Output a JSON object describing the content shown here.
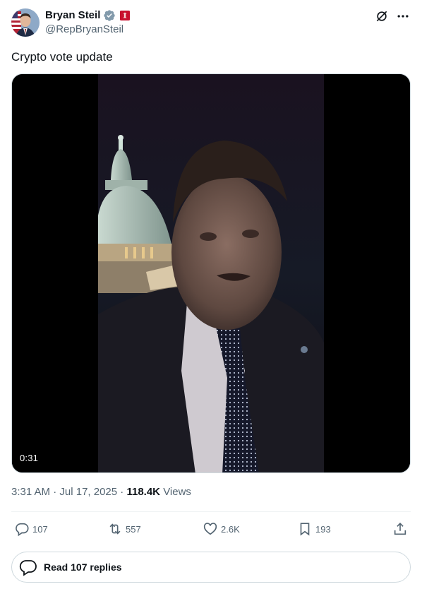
{
  "author": {
    "display_name": "Bryan Steil",
    "handle": "@RepBryanSteil",
    "verified_icon": "verified-badge-icon",
    "affiliation_icon": "house-seal-icon"
  },
  "tweet": {
    "text": "Crypto vote update"
  },
  "video": {
    "duration": "0:31"
  },
  "meta": {
    "time": "3:31 AM",
    "separator": "·",
    "date": "Jul 17, 2025",
    "views_count": "118.4K",
    "views_label": "Views"
  },
  "actions": {
    "replies": "107",
    "reposts": "557",
    "likes": "2.6K",
    "bookmarks": "193"
  },
  "read_replies": {
    "label": "Read 107 replies"
  },
  "colors": {
    "text_primary": "#0f1419",
    "text_secondary": "#536471",
    "border": "#cfd9de",
    "verified": "#829aab"
  }
}
